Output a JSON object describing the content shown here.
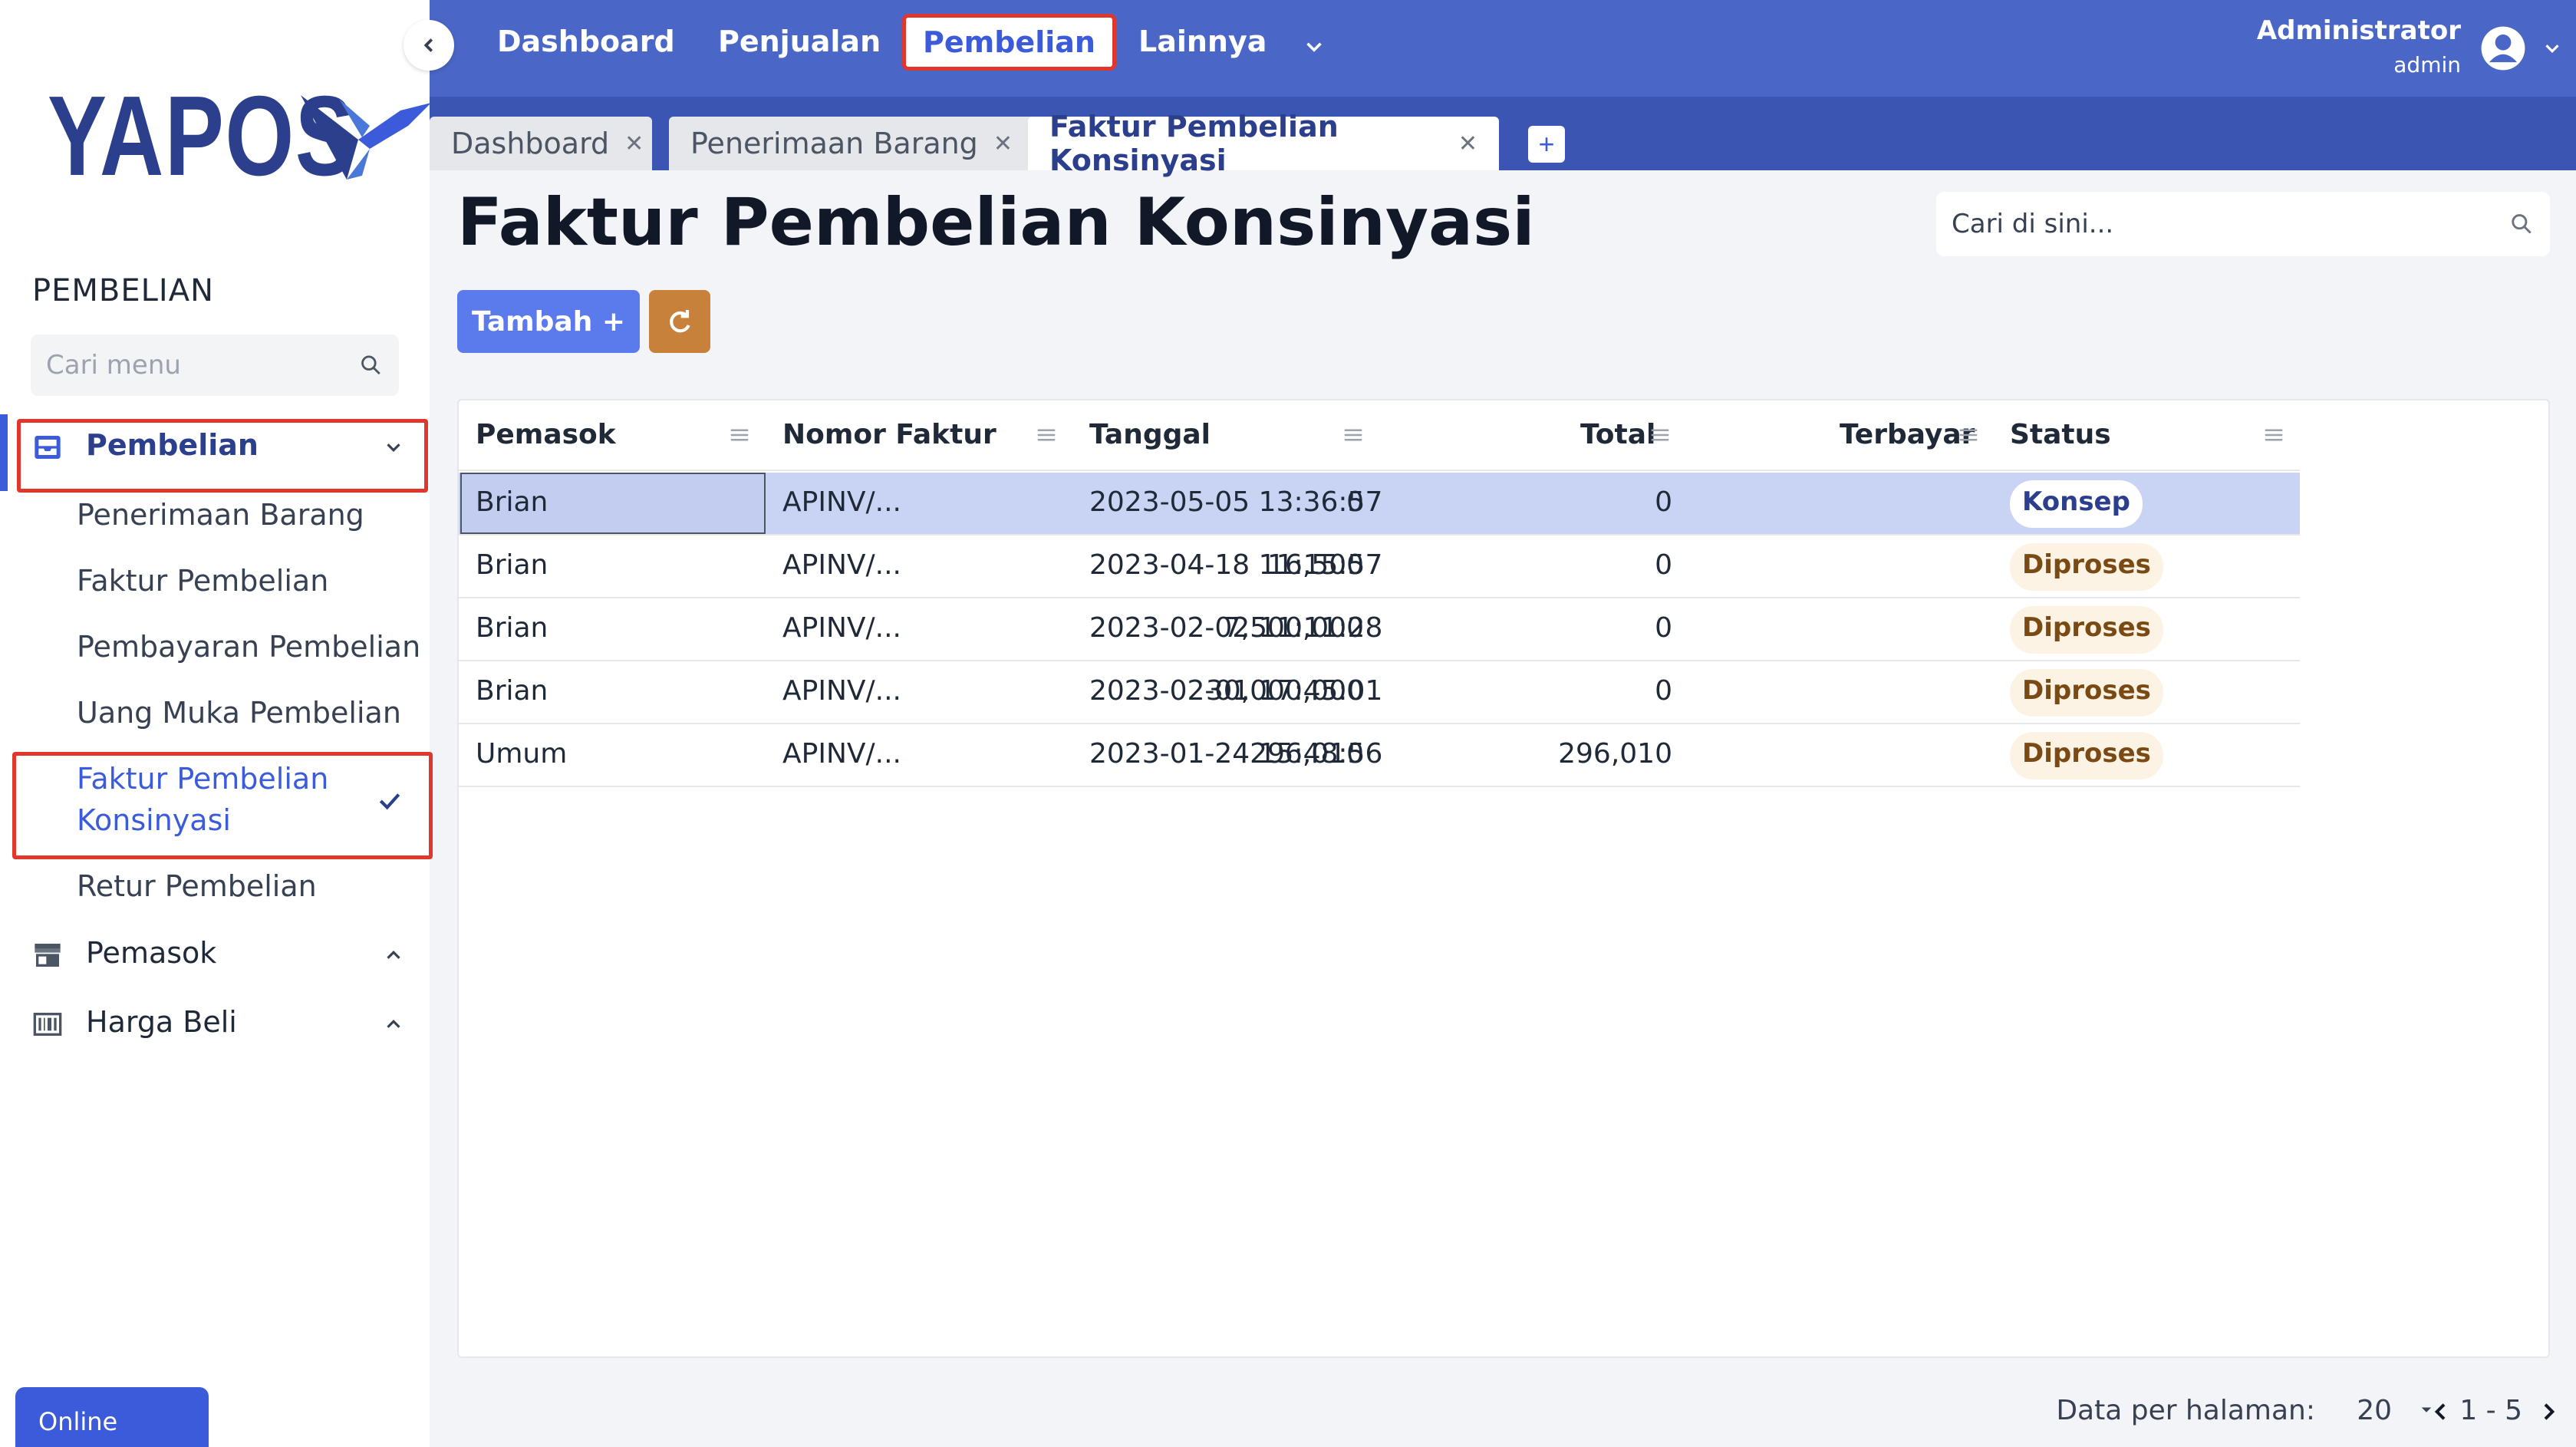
{
  "brand": {
    "logo_text": "YAPOS"
  },
  "sidebar": {
    "section_title": "PEMBELIAN",
    "search_placeholder": "Cari menu",
    "groups": [
      {
        "label": "Pembelian",
        "icon": "inbox-icon",
        "expanded": true
      },
      {
        "label": "Pemasok",
        "icon": "store-icon",
        "expanded": false
      },
      {
        "label": "Harga Beli",
        "icon": "barcode-icon",
        "expanded": false
      }
    ],
    "sub_items": [
      "Penerimaan Barang",
      "Faktur Pembelian",
      "Pembayaran Pembelian",
      "Uang Muka Pembelian",
      "Faktur Pembelian Konsinyasi",
      "Retur Pembelian"
    ],
    "online_label": "Online"
  },
  "topnav": {
    "items": [
      "Dashboard",
      "Penjualan",
      "Pembelian",
      "Lainnya"
    ],
    "active": "Pembelian"
  },
  "user": {
    "name": "Administrator",
    "role": "admin"
  },
  "tabs": [
    {
      "label": "Dashboard",
      "active": false
    },
    {
      "label": "Penerimaan Barang",
      "active": false
    },
    {
      "label": "Faktur Pembelian Konsinyasi",
      "active": true
    }
  ],
  "tab_add_label": "+",
  "page": {
    "title": "Faktur Pembelian Konsinyasi",
    "search_placeholder": "Cari di sini...",
    "add_button": "Tambah +"
  },
  "table": {
    "columns": [
      "Pemasok",
      "Nomor Faktur",
      "Tanggal",
      "Total",
      "Terbayar",
      "Status"
    ],
    "rows": [
      {
        "pemasok": "Brian",
        "nomor": "APINV/...",
        "tanggal": "2023-05-05 13:36:57",
        "total": "0",
        "terbayar": "0",
        "status": "Konsep"
      },
      {
        "pemasok": "Brian",
        "nomor": "APINV/...",
        "tanggal": "2023-04-18 11:15:57",
        "total": "16,500",
        "terbayar": "0",
        "status": "Diproses"
      },
      {
        "pemasok": "Brian",
        "nomor": "APINV/...",
        "tanggal": "2023-02-02 11:11:28",
        "total": "7,500,000",
        "terbayar": "0",
        "status": "Diproses"
      },
      {
        "pemasok": "Brian",
        "nomor": "APINV/...",
        "tanggal": "2023-02-01 17:45:01",
        "total": "30,000,000",
        "terbayar": "0",
        "status": "Diproses"
      },
      {
        "pemasok": "Umum",
        "nomor": "APINV/...",
        "tanggal": "2023-01-24 15:48:56",
        "total": "296,010",
        "terbayar": "296,010",
        "status": "Diproses"
      }
    ]
  },
  "pager": {
    "label": "Data per halaman:",
    "size": "20",
    "range": "1 - 5"
  },
  "colors": {
    "header": "#4a66c6",
    "tabbar": "#3b55b3",
    "accent": "#3b5bdb",
    "highlight": "#e0362c",
    "refresh": "#c8813a"
  }
}
